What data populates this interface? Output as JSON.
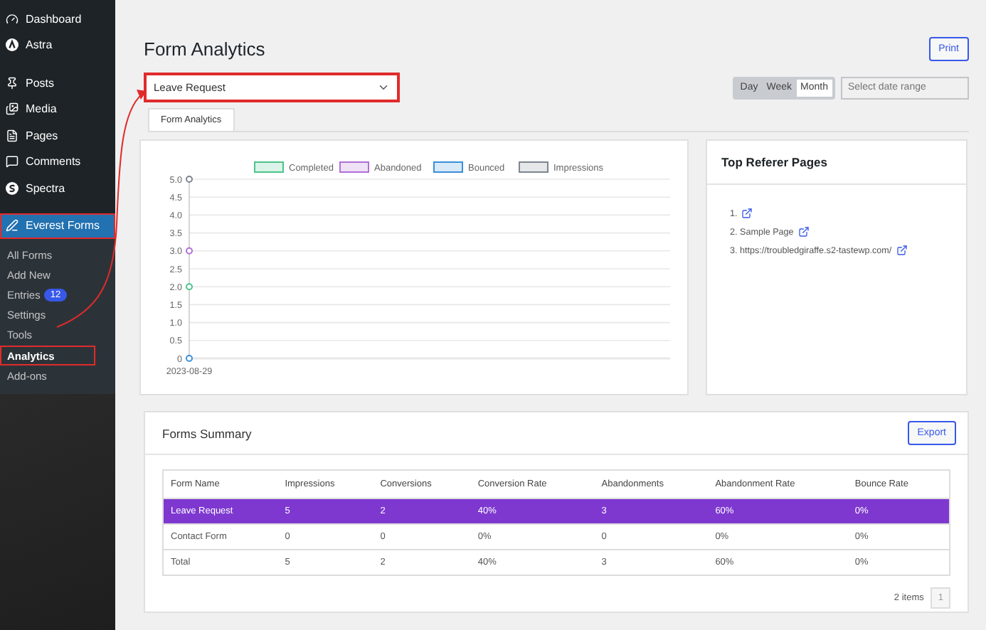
{
  "sidebar": {
    "items": [
      {
        "label": "Dashboard",
        "selected": false,
        "highlighted": false
      },
      {
        "label": "Astra",
        "selected": false,
        "highlighted": false
      },
      {
        "label": "Posts",
        "selected": false,
        "highlighted": false
      },
      {
        "label": "Media",
        "selected": false,
        "highlighted": false
      },
      {
        "label": "Pages",
        "selected": false,
        "highlighted": false
      },
      {
        "label": "Comments",
        "selected": false,
        "highlighted": false
      },
      {
        "label": "Spectra",
        "selected": false,
        "highlighted": false
      },
      {
        "label": "Everest Forms",
        "selected": true,
        "highlighted": true
      }
    ],
    "submenu": [
      {
        "label": "All Forms",
        "selected": false,
        "highlighted": false
      },
      {
        "label": "Add New",
        "selected": false,
        "highlighted": false
      },
      {
        "label": "Entries",
        "badge": "12",
        "selected": false,
        "highlighted": false
      },
      {
        "label": "Settings",
        "selected": false,
        "highlighted": false
      },
      {
        "label": "Tools",
        "selected": false,
        "highlighted": false
      },
      {
        "label": "Analytics",
        "selected": true,
        "highlighted": true
      },
      {
        "label": "Add-ons",
        "selected": false,
        "highlighted": false
      }
    ]
  },
  "page": {
    "title": "Form Analytics",
    "print_button": "Print"
  },
  "form_select": {
    "value": "Leave Request",
    "highlighted": true
  },
  "periods": [
    {
      "label": "Day",
      "selected": false
    },
    {
      "label": "Week",
      "selected": false
    },
    {
      "label": "Month",
      "selected": true
    }
  ],
  "date_range": {
    "placeholder": "Select date range"
  },
  "tabs": [
    {
      "label": "Form Analytics",
      "selected": true
    }
  ],
  "chart": {
    "chart_data": {
      "type": "line",
      "categories": [
        "2023-08-29"
      ],
      "ylim": [
        0,
        5
      ],
      "yticks": [
        {
          "value": 0,
          "label": "0"
        },
        {
          "value": 0.5,
          "label": "0.5"
        },
        {
          "value": 1,
          "label": "1.0"
        },
        {
          "value": 1.5,
          "label": "1.5"
        },
        {
          "value": 2,
          "label": "2.0"
        },
        {
          "value": 2.5,
          "label": "2.5"
        },
        {
          "value": 3,
          "label": "3.0"
        },
        {
          "value": 3.5,
          "label": "3.5"
        },
        {
          "value": 4,
          "label": "4.0"
        },
        {
          "value": 4.5,
          "label": "4.5"
        },
        {
          "value": 5,
          "label": "5.0"
        }
      ],
      "grid": true,
      "legend": "top",
      "series": [
        {
          "name": "Completed",
          "color": "#4cc38a",
          "values": [
            2
          ],
          "marker": "circle"
        },
        {
          "name": "Abandoned",
          "color": "#b06fd8",
          "values": [
            3
          ],
          "marker": "circle"
        },
        {
          "name": "Bounced",
          "color": "#3a8fd9",
          "values": [
            0
          ],
          "marker": "circle"
        },
        {
          "name": "Impressions",
          "color": "#7d8590",
          "values": [
            5
          ],
          "marker": "circle"
        }
      ]
    }
  },
  "referers": {
    "title": "Top Referer Pages",
    "items": [
      {
        "label": "1."
      },
      {
        "label": "2. Sample Page"
      },
      {
        "label": "3. https://troubledgiraffe.s2-tastewp.com/"
      }
    ]
  },
  "summary": {
    "title": "Forms Summary",
    "export_button": "Export",
    "columns": [
      "Form Name",
      "Impressions",
      "Conversions",
      "Conversion Rate",
      "Abandonments",
      "Abandonment Rate",
      "Bounce Rate"
    ],
    "rows": [
      {
        "cells": [
          "Leave Request",
          "5",
          "2",
          "40%",
          "3",
          "60%",
          "0%"
        ],
        "selected": true
      },
      {
        "cells": [
          "Contact Form",
          "0",
          "0",
          "0%",
          "0",
          "0%",
          "0%"
        ],
        "selected": false
      },
      {
        "cells": [
          "Total",
          "5",
          "2",
          "40%",
          "3",
          "60%",
          "0%"
        ],
        "selected": false
      }
    ],
    "count": "2 items",
    "page": "1"
  }
}
